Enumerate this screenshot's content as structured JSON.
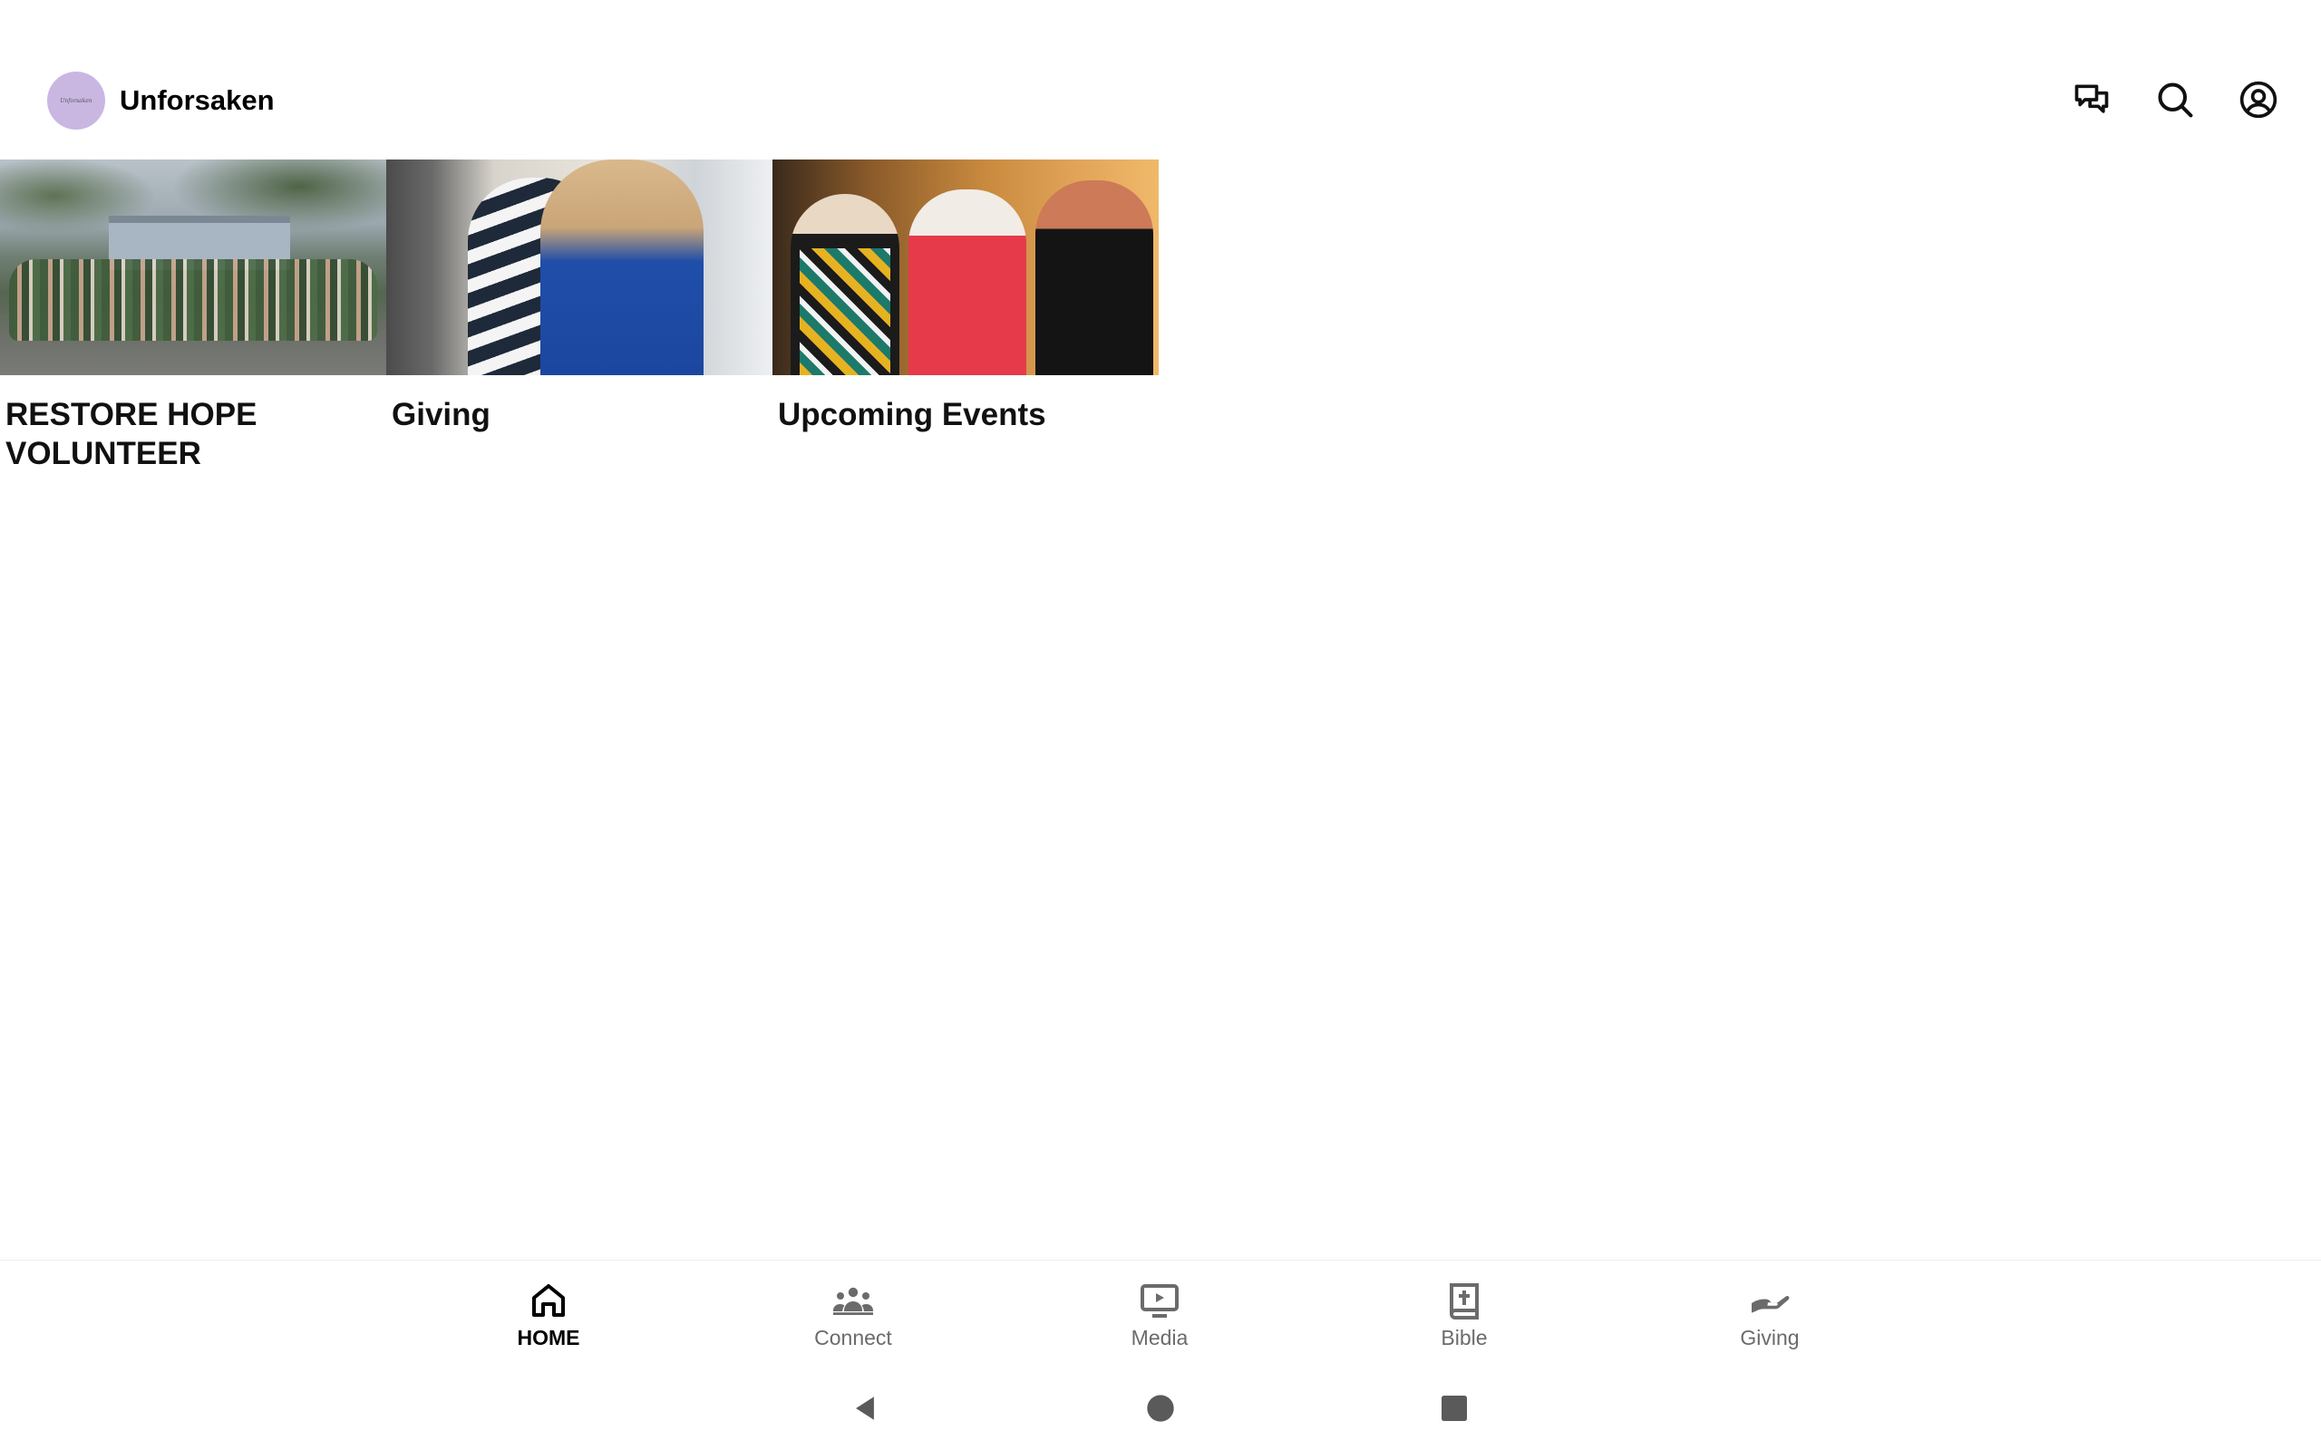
{
  "app": {
    "name": "Unforsaken",
    "logo_text": "Unforsaken"
  },
  "header": {
    "actions": [
      {
        "name": "messages",
        "icon": "chat-bubbles-icon"
      },
      {
        "name": "search",
        "icon": "search-icon"
      },
      {
        "name": "profile",
        "icon": "account-circle-icon"
      }
    ]
  },
  "cards": [
    {
      "title": "RESTORE HOPE VOLUNTEER",
      "image": "volunteer-group-photo"
    },
    {
      "title": "Giving",
      "image": "hug-photo"
    },
    {
      "title": "Upcoming Events",
      "image": "women-smiling-photo"
    }
  ],
  "bottom_nav": {
    "items": [
      {
        "label": "HOME",
        "icon": "home-icon",
        "active": true
      },
      {
        "label": "Connect",
        "icon": "people-group-icon",
        "active": false
      },
      {
        "label": "Media",
        "icon": "tv-play-icon",
        "active": false
      },
      {
        "label": "Bible",
        "icon": "bible-book-icon",
        "active": false
      },
      {
        "label": "Giving",
        "icon": "hand-giving-icon",
        "active": false
      }
    ]
  },
  "system_nav": {
    "buttons": [
      "back",
      "home",
      "recents"
    ]
  },
  "colors": {
    "brand_logo_bg": "#c9b7e2",
    "active_nav": "#000000",
    "inactive_nav": "#6b6b6b",
    "icon": "#111111"
  }
}
